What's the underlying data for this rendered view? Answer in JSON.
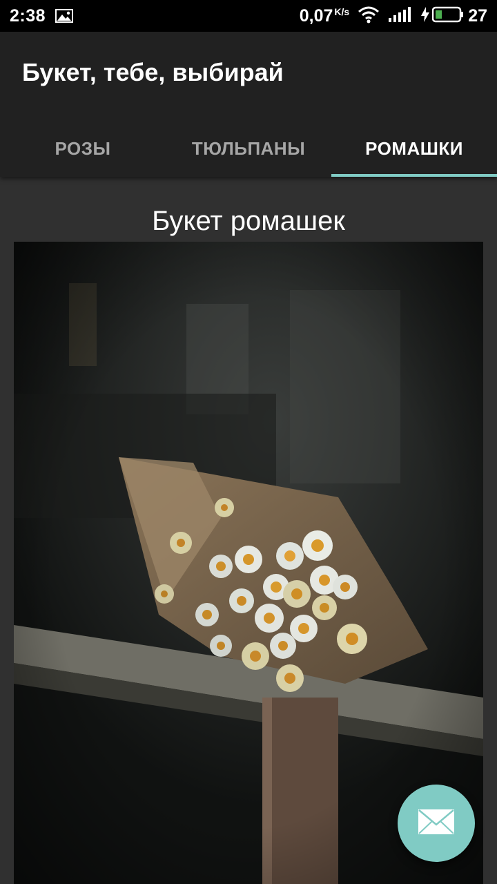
{
  "status_bar": {
    "time": "2:38",
    "network_speed": "0,07",
    "network_speed_unit": "K/s",
    "battery_level": "27",
    "icons": [
      "gallery-icon",
      "wifi-icon",
      "signal-icon",
      "charging-icon",
      "battery-icon"
    ]
  },
  "toolbar": {
    "title": "Букет, тебе, выбирай"
  },
  "tabs": [
    {
      "label": "РОЗЫ",
      "active": false
    },
    {
      "label": "ТЮЛЬПАНЫ",
      "active": false
    },
    {
      "label": "РОМАШКИ",
      "active": true
    }
  ],
  "content": {
    "title": "Букет ромашек",
    "image_subject": "bouquet of daisies wrapped in newspaper on a wooden railing"
  },
  "fab": {
    "icon": "mail-icon"
  },
  "colors": {
    "status_bar_bg": "#000000",
    "toolbar_bg": "#212121",
    "background": "#303030",
    "accent": "#80cbc4",
    "text_primary": "#ffffff",
    "tab_inactive": "#999999"
  }
}
